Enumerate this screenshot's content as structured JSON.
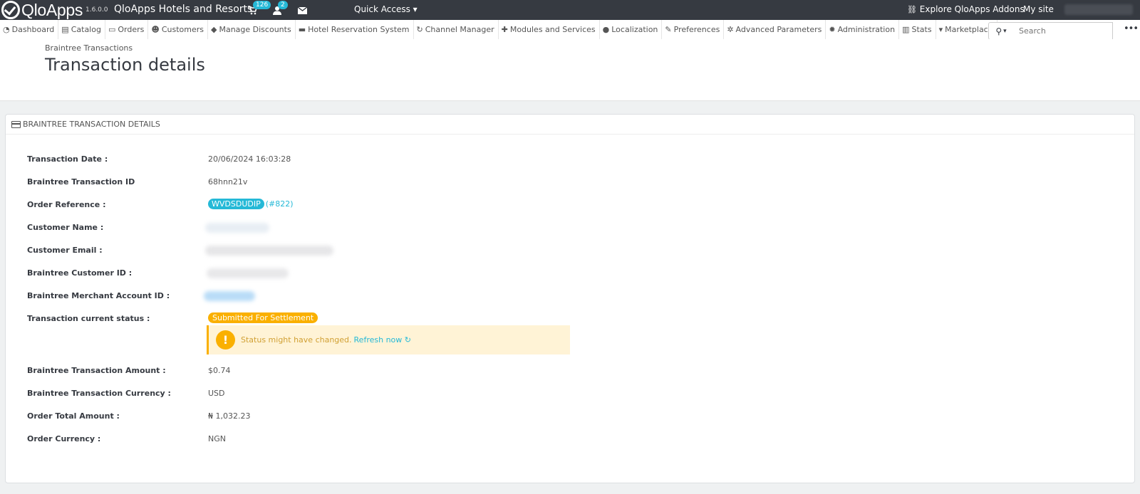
{
  "header": {
    "brand": "QloApps",
    "version": "1.6.0.0",
    "shop_name": "QloApps Hotels and Resorts",
    "cart_count": "126",
    "customer_count": "2",
    "quick_access": "Quick Access",
    "explore": "Explore QloApps Addons",
    "my_site": "My site"
  },
  "nav": {
    "items": [
      {
        "label": "Dashboard",
        "icon": "dashboard-icon"
      },
      {
        "label": "Catalog",
        "icon": "book-icon"
      },
      {
        "label": "Orders",
        "icon": "credit-card-icon"
      },
      {
        "label": "Customers",
        "icon": "users-icon"
      },
      {
        "label": "Manage Discounts",
        "icon": "tags-icon"
      },
      {
        "label": "Hotel Reservation System",
        "icon": "bed-icon"
      },
      {
        "label": "Channel Manager",
        "icon": "refresh-icon"
      },
      {
        "label": "Modules and Services",
        "icon": "puzzle-icon"
      },
      {
        "label": "Localization",
        "icon": "globe-icon"
      },
      {
        "label": "Preferences",
        "icon": "wrench-icon"
      },
      {
        "label": "Advanced Parameters",
        "icon": "cogs-icon"
      },
      {
        "label": "Administration",
        "icon": "cog-icon"
      },
      {
        "label": "Stats",
        "icon": "bar-chart-icon"
      },
      {
        "label": "Marketplace",
        "icon": "cart-icon"
      }
    ],
    "search_placeholder": "Search"
  },
  "page": {
    "breadcrumb": "Braintree Transactions",
    "title": "Transaction details"
  },
  "panel": {
    "heading": "Braintree Transaction Details",
    "fields": {
      "date_label": "Transaction Date :",
      "date_value": "20/06/2024 16:03:28",
      "txn_id_label": "Braintree Transaction ID",
      "txn_id_value": "68hnn21v",
      "order_ref_label": "Order Reference :",
      "order_ref_value": "WVDSDUDIP",
      "order_ref_id": "(#822)",
      "customer_name_label": "Customer Name :",
      "customer_email_label": "Customer Email :",
      "customer_id_label": "Braintree Customer ID :",
      "merchant_id_label": "Braintree Merchant Account ID :",
      "status_label": "Transaction current status :",
      "status_value": "Submitted For Settlement",
      "amount_label": "Braintree Transaction Amount :",
      "amount_value": "$0.74",
      "currency_label": "Braintree Transaction Currency :",
      "currency_value": "USD",
      "order_total_label": "Order Total Amount :",
      "order_total_value": "₦ 1,032.23",
      "order_currency_label": "Order Currency :",
      "order_currency_value": "NGN"
    },
    "alert": {
      "text": "Status might have changed.",
      "link": "Refresh now"
    }
  },
  "colors": {
    "header_bg": "#363a41",
    "accent": "#25b9d7",
    "warning": "#fab000"
  }
}
